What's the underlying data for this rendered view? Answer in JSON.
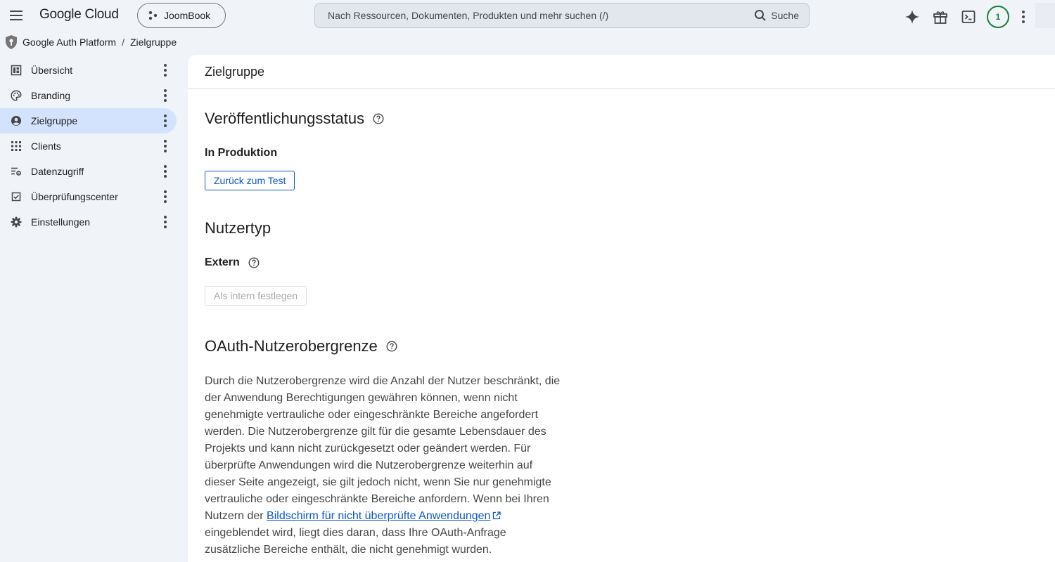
{
  "topbar": {
    "logo": "Google Cloud",
    "project": "JoomBook",
    "search_placeholder": "Nach Ressourcen, Dokumenten, Produkten und mehr suchen (/)",
    "search_button": "Suche",
    "avatar_initial": "1"
  },
  "breadcrumb": {
    "parent": "Google Auth Platform",
    "separator": "/",
    "current": "Zielgruppe"
  },
  "sidebar": {
    "items": [
      {
        "label": "Übersicht",
        "icon": "dashboard-icon"
      },
      {
        "label": "Branding",
        "icon": "palette-icon"
      },
      {
        "label": "Zielgruppe",
        "icon": "person-icon",
        "active": true
      },
      {
        "label": "Clients",
        "icon": "grid-icon"
      },
      {
        "label": "Datenzugriff",
        "icon": "data-access-icon"
      },
      {
        "label": "Überprüfungscenter",
        "icon": "check-box-icon"
      },
      {
        "label": "Einstellungen",
        "icon": "gear-icon"
      }
    ]
  },
  "main": {
    "title": "Zielgruppe",
    "publishing": {
      "heading": "Veröffentlichungsstatus",
      "status": "In Produktion",
      "button": "Zurück zum Test"
    },
    "user_type": {
      "heading": "Nutzertyp",
      "value": "Extern",
      "button": "Als intern festlegen"
    },
    "oauth_cap": {
      "heading": "OAuth-Nutzerobergrenze",
      "text_before_link": "Durch die Nutzerobergrenze wird die Anzahl der Nutzer beschränkt, die der Anwendung Berechtigungen gewähren können, wenn nicht genehmigte vertrauliche oder eingeschränkte Bereiche angefordert werden. Die Nutzerobergrenze gilt für die gesamte Lebensdauer des Projekts und kann nicht zurückgesetzt oder geändert werden. Für überprüfte Anwendungen wird die Nutzerobergrenze weiterhin auf dieser Seite angezeigt, sie gilt jedoch nicht, wenn Sie nur genehmigte vertrauliche oder eingeschränkte Bereiche anfordern. Wenn bei Ihren Nutzern der ",
      "link": "Bildschirm für nicht überprüfte Anwendungen",
      "text_after_link": " eingeblendet wird, liegt dies daran, dass Ihre OAuth-Anfrage zusätzliche Bereiche enthält, die nicht genehmigt wurden."
    }
  },
  "colors": {
    "accent": "#0b57d0",
    "active_nav": "#d3e3fd",
    "avatar_ring": "#188038",
    "background": "#f0f4f9"
  }
}
